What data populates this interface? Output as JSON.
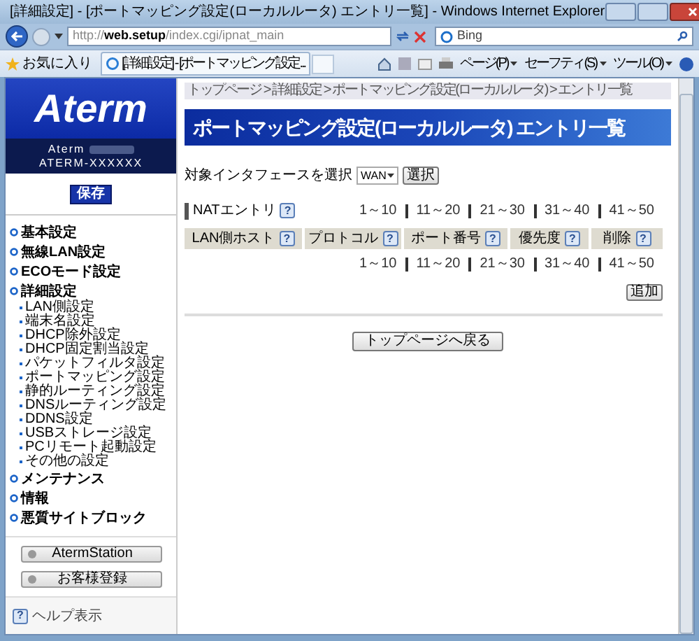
{
  "window": {
    "title": "[詳細設定] - [ポートマッピング設定(ローカルルータ) エントリ一覧] - Windows Internet Explorer"
  },
  "address_bar": {
    "url_prefix": "http://",
    "url_host": "web.setup",
    "url_path": "/index.cgi/ipnat_main"
  },
  "search": {
    "placeholder": "Bing"
  },
  "favorites": {
    "label": "お気に入り"
  },
  "tab": {
    "title": "[詳細設定] - [ポートマッピング設定..."
  },
  "command_menus": [
    "ページ(P)",
    "セーフティ(S)",
    "ツール(O)"
  ],
  "help_glyph": "?",
  "sidebar": {
    "logo": "Aterm",
    "model": "Aterm",
    "device": "ATERM-XXXXXX",
    "save_button": "保存",
    "nav": [
      {
        "label": "基本設定"
      },
      {
        "label": "無線LAN設定"
      },
      {
        "label": "ECOモード設定"
      },
      {
        "label": "詳細設定",
        "children": [
          {
            "label": "LAN側設定"
          },
          {
            "label": "端末名設定"
          },
          {
            "label": "DHCP除外設定"
          },
          {
            "label": "DHCP固定割当設定"
          },
          {
            "label": "パケットフィルタ設定"
          },
          {
            "label": "ポートマッピング設定"
          },
          {
            "label": "静的ルーティング設定"
          },
          {
            "label": "DNSルーティング設定"
          },
          {
            "label": "DDNS設定"
          },
          {
            "label": "USBストレージ設定"
          },
          {
            "label": "PCリモート起動設定"
          },
          {
            "label": "その他の設定"
          }
        ]
      },
      {
        "label": "メンテナンス"
      },
      {
        "label": "情報"
      },
      {
        "label": "悪質サイトブロック"
      }
    ],
    "buttons": [
      "AtermStation",
      "お客様登録"
    ],
    "help": "ヘルプ表示"
  },
  "main": {
    "breadcrumb": "トップページ > 詳細設定 > ポートマッピング設定(ローカルルータ) > エントリ一覧",
    "heading": "ポートマッピング設定(ローカルルータ) エントリ一覧",
    "interface_label": "対象インタフェースを選択",
    "interface_value": "WAN",
    "select_button": "選択",
    "section_title": "NATエントリ",
    "pages_top": [
      "1～10",
      "11～20",
      "21～30",
      "31～40",
      "41～50"
    ],
    "columns": [
      "LAN側ホスト",
      "プロトコル",
      "ポート番号",
      "優先度",
      "削除"
    ],
    "pages_bottom": [
      "1～10",
      "11～20",
      "21～30",
      "31～40",
      "41～50"
    ],
    "add_button": "追加",
    "back_button": "トップページへ戻る"
  }
}
